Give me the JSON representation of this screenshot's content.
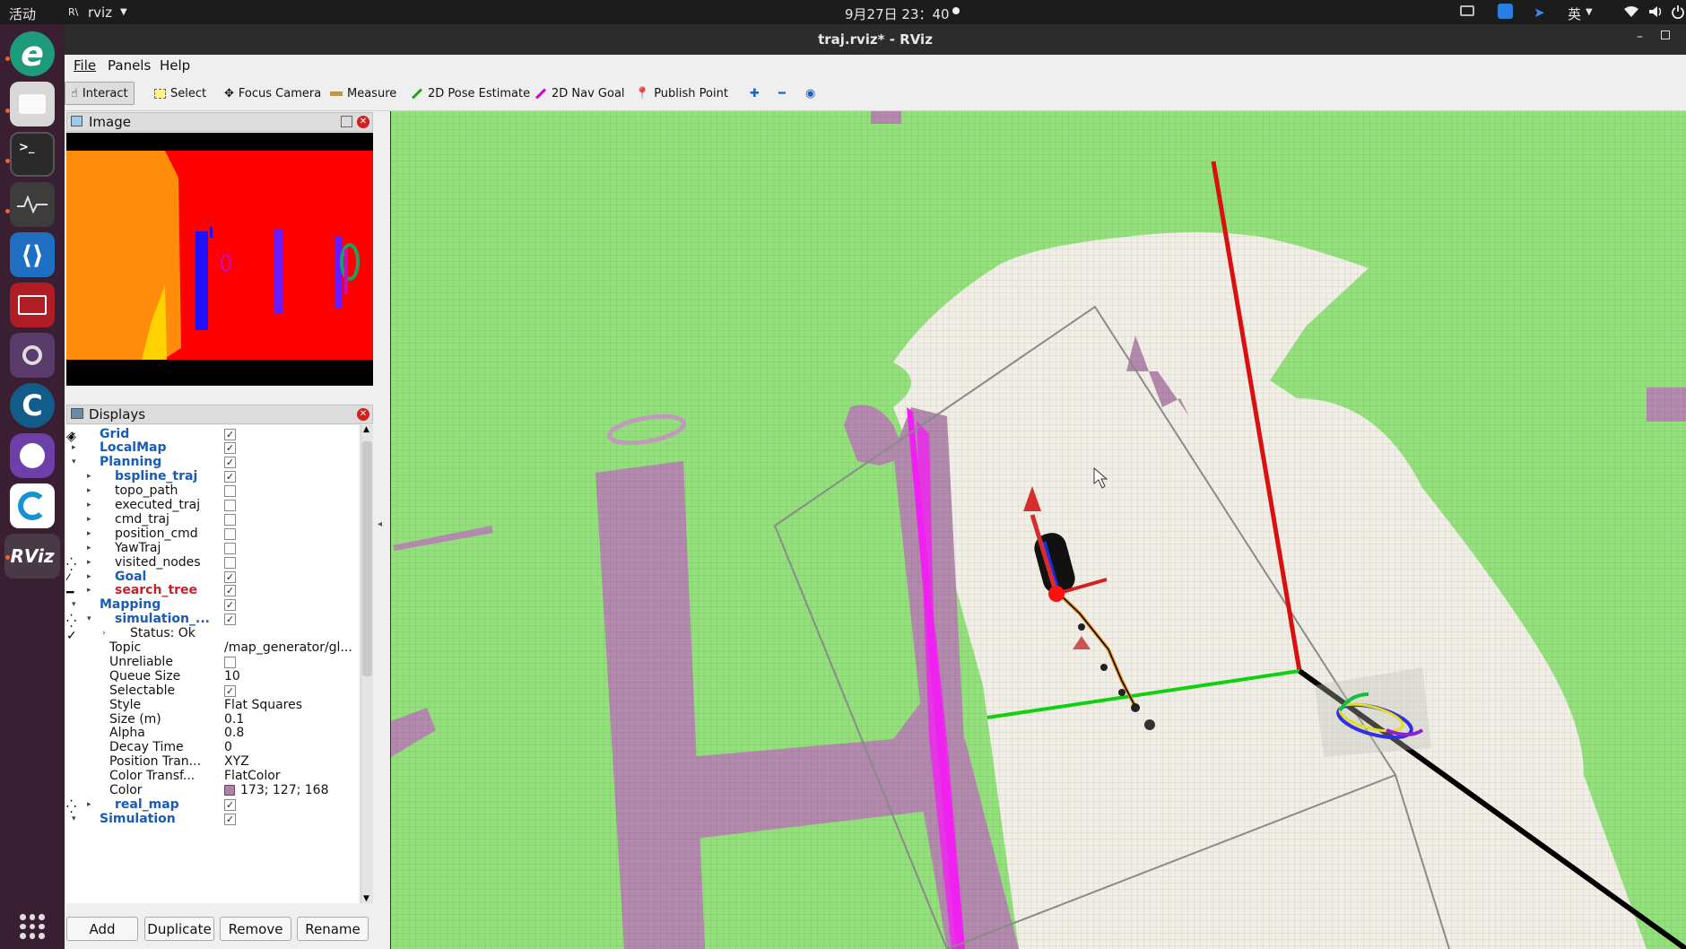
{
  "topbar": {
    "activities": "活动",
    "app_name": "rviz",
    "app_badge": "R\\",
    "clock": "9月27日 23：40",
    "ime": "英"
  },
  "window": {
    "title": "traj.rviz* - RViz"
  },
  "menu": {
    "file": "File",
    "panels": "Panels",
    "help": "Help"
  },
  "toolbar": {
    "interact": "Interact",
    "select": "Select",
    "focus_camera": "Focus Camera",
    "measure": "Measure",
    "pose_estimate": "2D Pose Estimate",
    "nav_goal": "2D Nav Goal",
    "publish_point": "Publish Point",
    "colors": {
      "pose": "#1fa51f",
      "goal": "#d400c8",
      "point": "#c0392b"
    }
  },
  "image_panel": {
    "title": "Image"
  },
  "displays_panel": {
    "title": "Displays"
  },
  "dock": {
    "rviz_label": "RViz",
    "icons": [
      "edge-browser-icon",
      "files-icon",
      "terminal-icon",
      "system-monitor-icon",
      "vscode-icon",
      "app-icon",
      "video-icon",
      "cloud-icon",
      "github-icon",
      "sync-icon",
      "rviz-icon"
    ]
  },
  "tree": [
    {
      "label": "Grid",
      "style": "b",
      "depth": 0,
      "arrow": "▸",
      "icon": "grid",
      "checked": true
    },
    {
      "label": "LocalMap",
      "style": "b",
      "depth": 0,
      "arrow": "▸",
      "icon": "folder",
      "checked": true
    },
    {
      "label": "Planning",
      "style": "b",
      "depth": 0,
      "arrow": "▾",
      "icon": "folder",
      "checked": true
    },
    {
      "label": "bspline_traj",
      "style": "b",
      "depth": 1,
      "arrow": "▸",
      "icon": "marker",
      "checked": true
    },
    {
      "label": "topo_path",
      "style": "n",
      "depth": 1,
      "arrow": "▸",
      "icon": "marker",
      "checked": false
    },
    {
      "label": "executed_traj",
      "style": "n",
      "depth": 1,
      "arrow": "▸",
      "icon": "marker",
      "checked": false
    },
    {
      "label": "cmd_traj",
      "style": "n",
      "depth": 1,
      "arrow": "▸",
      "icon": "marker",
      "checked": false
    },
    {
      "label": "position_cmd",
      "style": "n",
      "depth": 1,
      "arrow": "▸",
      "icon": "marker",
      "checked": false
    },
    {
      "label": "YawTraj",
      "style": "n",
      "depth": 1,
      "arrow": "▸",
      "icon": "marker",
      "checked": false
    },
    {
      "label": "visited_nodes",
      "style": "n",
      "depth": 1,
      "arrow": "▸",
      "icon": "cloud",
      "checked": false
    },
    {
      "label": "Goal",
      "style": "b",
      "depth": 1,
      "arrow": "▸",
      "icon": "goal",
      "checked": true
    },
    {
      "label": "search_tree",
      "style": "r",
      "depth": 1,
      "arrow": "▸",
      "icon": "error",
      "checked": true
    },
    {
      "label": "Mapping",
      "style": "b",
      "depth": 0,
      "arrow": "▾",
      "icon": "folder",
      "checked": true
    },
    {
      "label": "simulation_...",
      "style": "b",
      "depth": 1,
      "arrow": "▾",
      "icon": "cloud",
      "checked": true
    },
    {
      "label": "Status: Ok",
      "style": "n",
      "depth": 2,
      "arrow": "›",
      "icon": "ok"
    },
    {
      "label": "Topic",
      "style": "n",
      "depth": 2,
      "value": "/map_generator/gl..."
    },
    {
      "label": "Unreliable",
      "style": "n",
      "depth": 2,
      "checked": false
    },
    {
      "label": "Queue Size",
      "style": "n",
      "depth": 2,
      "value": "10"
    },
    {
      "label": "Selectable",
      "style": "n",
      "depth": 2,
      "checked": true
    },
    {
      "label": "Style",
      "style": "n",
      "depth": 2,
      "value": "Flat Squares"
    },
    {
      "label": "Size (m)",
      "style": "n",
      "depth": 2,
      "value": "0.1"
    },
    {
      "label": "Alpha",
      "style": "n",
      "depth": 2,
      "value": "0.8"
    },
    {
      "label": "Decay Time",
      "style": "n",
      "depth": 2,
      "value": "0"
    },
    {
      "label": "Position Tran...",
      "style": "n",
      "depth": 2,
      "value": "XYZ"
    },
    {
      "label": "Color Transf...",
      "style": "n",
      "depth": 2,
      "value": "FlatColor"
    },
    {
      "label": "Color",
      "style": "n",
      "depth": 2,
      "value": "173; 127; 168",
      "swatch": "#ad7fa8"
    },
    {
      "label": "real_map",
      "style": "b",
      "depth": 1,
      "arrow": "▸",
      "icon": "cloud",
      "checked": true
    },
    {
      "label": "Simulation",
      "style": "b",
      "depth": 0,
      "arrow": "▾",
      "icon": "folder",
      "checked": true
    }
  ],
  "buttons": {
    "add": "Add",
    "duplicate": "Duplicate",
    "remove": "Remove",
    "rename": "Rename"
  }
}
